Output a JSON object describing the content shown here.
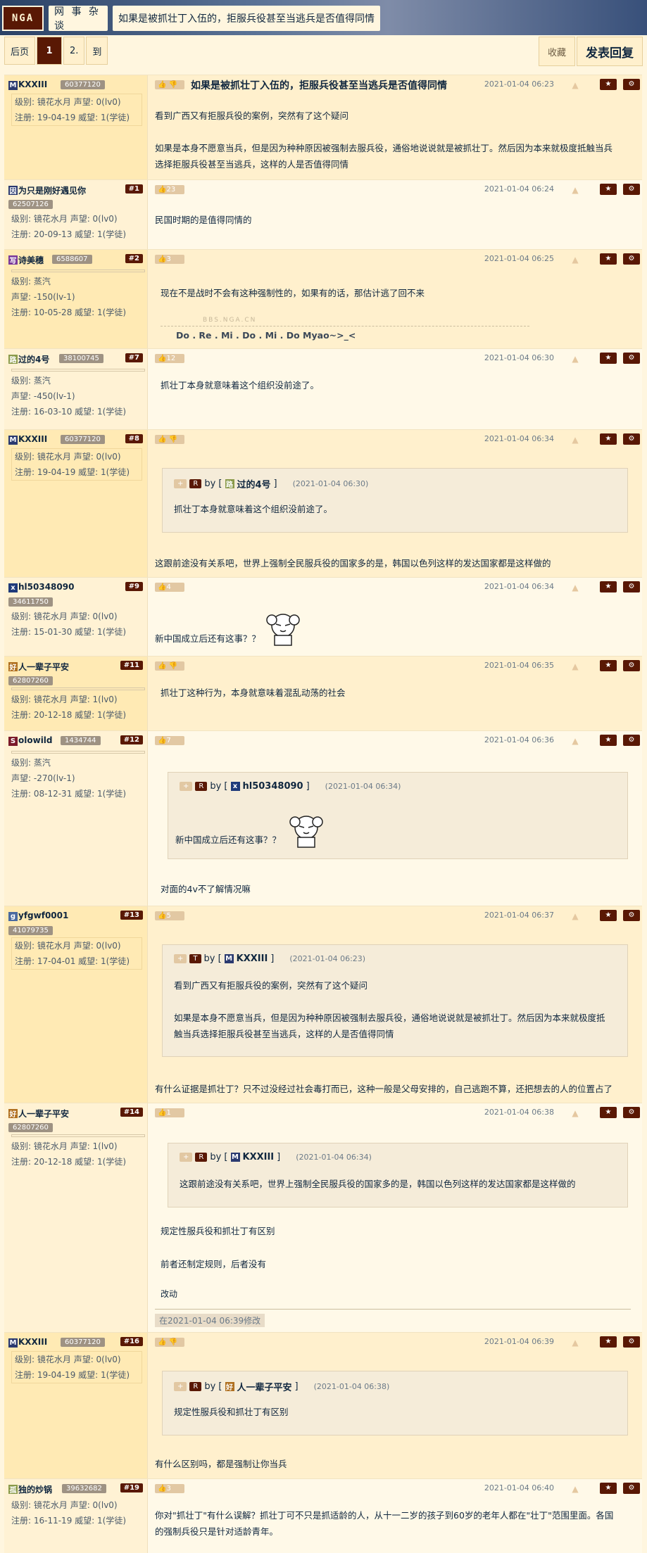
{
  "header": {
    "logo": "NGA",
    "forum": "网 事 杂 谈",
    "thread_title": "如果是被抓壮丁入伍的，拒服兵役甚至当逃兵是否值得同情"
  },
  "pager": {
    "back": "后页",
    "p1": "1",
    "p2": "2.",
    "to": "到"
  },
  "actions": {
    "collect": "收藏",
    "reply": "发表回复"
  },
  "posts": [
    {
      "floor": "",
      "avatar": "M",
      "name": "KXXIII",
      "uid": "60377120",
      "meta1": "级别: 镜花水月",
      "meta1b": "声望: 0(lv0)",
      "meta2": "注册: 19-04-19",
      "meta2b": "威望: 1(学徒)",
      "likes": "",
      "title": "如果是被抓壮丁入伍的，拒服兵役甚至当逃兵是否值得同情",
      "time": "2021-01-04 06:23",
      "lines": [
        "看到广西又有拒服兵役的案例，突然有了这个疑问",
        "如果是本身不愿意当兵，但是因为种种原因被强制去服兵役，通俗地说说就是被抓壮丁。然后因为本来就极度抵触当兵",
        "选择拒服兵役甚至当逃兵，这样的人是否值得同情"
      ]
    },
    {
      "floor": "#1",
      "avatar": "因",
      "name": "为只是刚好遇见你",
      "uid": "62507126",
      "meta1": "级别: 镜花水月",
      "meta1b": "声望: 0(lv0)",
      "meta2": "注册: 20-09-13",
      "meta2b": "威望: 1(学徒)",
      "likes": "23",
      "time": "2021-01-04 06:24",
      "lines": [
        "民国时期的是值得同情的"
      ]
    },
    {
      "floor": "#2",
      "avatar": "写",
      "name": "诗美穗",
      "uid": "6588607",
      "meta1": "级别: 蒸汽",
      "meta1b": "声望: -150(lv-1)",
      "meta2": "注册: 10-05-28",
      "meta2b": "威望: 1(学徒)",
      "likes": "3",
      "time": "2021-01-04 06:25",
      "lines": [
        "现在不是战时不会有这种强制性的，如果有的话，那估计逃了回不来"
      ],
      "sig_wm": "BBS.NGA.CN",
      "sig": "Do . Re . Mi . Do . Mi . Do Myao~>_<"
    },
    {
      "floor": "#7",
      "avatar": "路",
      "name": "过的4号",
      "uid": "38100745",
      "meta1": "级别: 蒸汽",
      "meta1b": "声望: -450(lv-1)",
      "meta2": "注册: 16-03-10",
      "meta2b": "威望: 1(学徒)",
      "likes": "12",
      "time": "2021-01-04 06:30",
      "lines": [
        "抓壮丁本身就意味着这个组织没前途了。"
      ]
    },
    {
      "floor": "#8",
      "avatar": "M",
      "name": "KXXIII",
      "uid": "60377120",
      "meta1": "级别: 镜花水月",
      "meta1b": "声望: 0(lv0)",
      "meta2": "注册: 19-04-19",
      "meta2b": "威望: 1(学徒)",
      "likes": "",
      "time": "2021-01-04 06:34",
      "quote": {
        "tag": "+",
        "type": "R",
        "by": "by [",
        "avatar": "路",
        "name": "过的4号",
        "close": "]",
        "time": "(2021-01-04 06:30)",
        "lines": [
          "抓壮丁本身就意味着这个组织没前途了。"
        ]
      },
      "lines": [
        "这跟前途没有关系吧，世界上强制全民服兵役的国家多的是，韩国以色列这样的发达国家都是这样做的"
      ]
    },
    {
      "floor": "#9",
      "avatar": "x",
      "name": "hl50348090",
      "uid": "34611750",
      "meta1": "级别: 镜花水月",
      "meta1b": "声望: 0(lv0)",
      "meta2": "注册: 15-01-30",
      "meta2b": "威望: 1(学徒)",
      "likes": "4",
      "time": "2021-01-04 06:34",
      "lines": [
        "新中国成立后还有这事？？"
      ]
    },
    {
      "floor": "#11",
      "avatar": "好",
      "name": "人一辈子平安",
      "uid": "62807260",
      "meta1": "级别: 镜花水月",
      "meta1b": "声望: 1(lv0)",
      "meta2": "注册: 20-12-18",
      "meta2b": "威望: 1(学徒)",
      "likes": "",
      "time": "2021-01-04 06:35",
      "lines": [
        "抓壮丁这种行为，本身就意味着混乱动荡的社会"
      ]
    },
    {
      "floor": "#12",
      "avatar": "S",
      "name": "olowild",
      "uid": "1434744",
      "meta1": "级别: 蒸汽",
      "meta1b": "声望: -270(lv-1)",
      "meta2": "注册: 08-12-31",
      "meta2b": "威望: 1(学徒)",
      "likes": "7",
      "time": "2021-01-04 06:36",
      "quote": {
        "tag": "+",
        "type": "R",
        "by": "by [",
        "avatar": "x",
        "name": "hl50348090",
        "close": "]",
        "time": "(2021-01-04 06:34)",
        "lines": [
          "新中国成立后还有这事？？"
        ]
      },
      "lines": [
        "对面的4v不了解情况嘛"
      ]
    },
    {
      "floor": "#13",
      "avatar": "g",
      "name": "yfgwf0001",
      "uid": "41079735",
      "meta1": "级别: 镜花水月",
      "meta1b": "声望: 0(lv0)",
      "meta2": "注册: 17-04-01",
      "meta2b": "威望: 1(学徒)",
      "likes": "5",
      "time": "2021-01-04 06:37",
      "quote": {
        "tag": "+",
        "type": "T",
        "by": "by [",
        "avatar": "M",
        "name": "KXXIII",
        "close": "]",
        "time": "(2021-01-04 06:23)",
        "lines": [
          "看到广西又有拒服兵役的案例，突然有了这个疑问",
          "如果是本身不愿意当兵，但是因为种种原因被强制去服兵役，通俗地说说就是被抓壮丁。然后因为本来就极度抵",
          "触当兵选择拒服兵役甚至当逃兵，这样的人是否值得同情"
        ]
      },
      "lines": [
        "有什么证据是抓壮丁？只不过没经过社会毒打而已，这种一般是父母安排的，自己逃跑不算，还把想去的人的位置占了"
      ]
    },
    {
      "floor": "#14",
      "avatar": "好",
      "name": "人一辈子平安",
      "uid": "62807260",
      "meta1": "级别: 镜花水月",
      "meta1b": "声望: 1(lv0)",
      "meta2": "注册: 20-12-18",
      "meta2b": "威望: 1(学徒)",
      "likes": "1",
      "time": "2021-01-04 06:38",
      "quote": {
        "tag": "+",
        "type": "R",
        "by": "by [",
        "avatar": "M",
        "name": "KXXIII",
        "close": "]",
        "time": "(2021-01-04 06:34)",
        "lines": [
          "这跟前途没有关系吧，世界上强制全民服兵役的国家多的是，韩国以色列这样的发达国家都是这样做的"
        ]
      },
      "lines": [
        "规定性服兵役和抓壮丁有区别",
        "前者还制定规则，后者没有"
      ],
      "edit_label": "改动",
      "edit": "在2021-01-04 06:39修改"
    },
    {
      "floor": "#16",
      "avatar": "M",
      "name": "KXXIII",
      "uid": "60377120",
      "meta1": "级别: 镜花水月",
      "meta1b": "声望: 0(lv0)",
      "meta2": "注册: 19-04-19",
      "meta2b": "威望: 1(学徒)",
      "likes": "",
      "time": "2021-01-04 06:39",
      "quote": {
        "tag": "+",
        "type": "R",
        "by": "by [",
        "avatar": "好",
        "name": "人一辈子平安",
        "close": "]",
        "time": "(2021-01-04 06:38)",
        "lines": [
          "规定性服兵役和抓壮丁有区别"
        ]
      },
      "lines": [
        "有什么区别吗，都是强制让你当兵"
      ]
    },
    {
      "floor": "#19",
      "avatar": "孤",
      "name": "独的炒锅",
      "uid": "39632682",
      "meta1": "级别: 镜花水月",
      "meta1b": "声望: 0(lv0)",
      "meta2": "注册: 16-11-19",
      "meta2b": "威望: 1(学徒)",
      "likes": "3",
      "time": "2021-01-04 06:40",
      "lines": [
        "你对\"抓壮丁\"有什么误解？抓壮丁可不只是抓适龄的人，从十一二岁的孩子到60岁的老年人都在\"壮丁\"范围里面。各国",
        "的强制兵役只是针对适龄青年。"
      ]
    }
  ]
}
